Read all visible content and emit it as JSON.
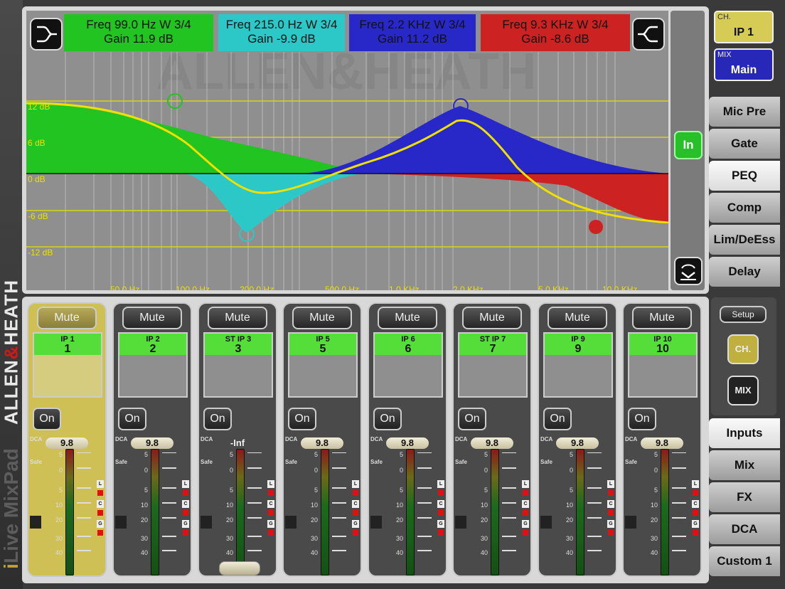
{
  "brand": {
    "allen": "ALLEN",
    "amp": "&",
    "heath": "HEATH",
    "ilive": "i",
    "ilive_rest": "Live MixPad"
  },
  "eq": {
    "bands": [
      {
        "freq": "Freq 99.0 Hz W 3/4",
        "gain": "Gain 11.9 dB",
        "color": "#22c422"
      },
      {
        "freq": "Freq 215.0 Hz W 3/4",
        "gain": "Gain -9.9 dB",
        "color": "#2cc8c8"
      },
      {
        "freq": "Freq 2.2 KHz W 3/4",
        "gain": "Gain 11.2 dB",
        "color": "#2828c8"
      },
      {
        "freq": "Freq 9.3 KHz W 3/4",
        "gain": "Gain -8.6 dB",
        "color": "#cc2222"
      }
    ],
    "db_labels": [
      "12 dB",
      "6 dB",
      "0 dB",
      "-6 dB",
      "-12 dB"
    ],
    "freq_labels": [
      "50.0 Hz",
      "100.0 Hz",
      "200.0 Hz",
      "500.0 Hz",
      "1.0 KHz",
      "2.0 KHz",
      "5.0 KHz",
      "10.0 KHz"
    ],
    "in_label": "In"
  },
  "selectors": {
    "ch": {
      "small": "CH.",
      "big": "IP 1"
    },
    "mix": {
      "small": "MIX",
      "big": "Main"
    }
  },
  "tabs_top": [
    "Mic Pre",
    "Gate",
    "PEQ",
    "Comp",
    "Lim/DeEss",
    "Delay"
  ],
  "tabs_bottom": [
    "Inputs",
    "Mix",
    "FX",
    "DCA",
    "Custom 1"
  ],
  "strips": [
    {
      "label": "IP 1",
      "num": "1",
      "fader": "9.8"
    },
    {
      "label": "IP 2",
      "num": "2",
      "fader": "9.8"
    },
    {
      "label": "ST IP 3",
      "num": "3",
      "fader": "-Inf"
    },
    {
      "label": "IP 5",
      "num": "5",
      "fader": "9.8"
    },
    {
      "label": "IP 6",
      "num": "6",
      "fader": "9.8"
    },
    {
      "label": "ST IP 7",
      "num": "7",
      "fader": "9.8"
    },
    {
      "label": "IP 9",
      "num": "9",
      "fader": "9.8"
    },
    {
      "label": "IP 10",
      "num": "10",
      "fader": "9.8"
    }
  ],
  "strip_labels": {
    "mute": "Mute",
    "on": "On",
    "dca": "DCA",
    "safe": "Safe",
    "ind_l": "L",
    "ind_c": "C",
    "ind_g": "G"
  },
  "scale_labels": [
    "5",
    "0",
    "5",
    "10",
    "20",
    "30",
    "40"
  ],
  "mini": {
    "setup": "Setup",
    "ch": "CH.",
    "mix": "MIX"
  }
}
